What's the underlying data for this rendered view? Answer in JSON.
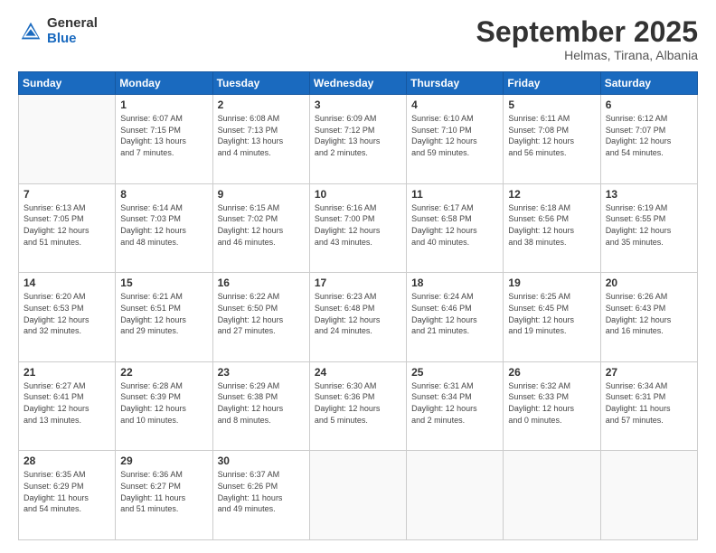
{
  "logo": {
    "general": "General",
    "blue": "Blue"
  },
  "header": {
    "month": "September 2025",
    "location": "Helmas, Tirana, Albania"
  },
  "weekdays": [
    "Sunday",
    "Monday",
    "Tuesday",
    "Wednesday",
    "Thursday",
    "Friday",
    "Saturday"
  ],
  "weeks": [
    [
      {
        "day": "",
        "info": ""
      },
      {
        "day": "1",
        "info": "Sunrise: 6:07 AM\nSunset: 7:15 PM\nDaylight: 13 hours\nand 7 minutes."
      },
      {
        "day": "2",
        "info": "Sunrise: 6:08 AM\nSunset: 7:13 PM\nDaylight: 13 hours\nand 4 minutes."
      },
      {
        "day": "3",
        "info": "Sunrise: 6:09 AM\nSunset: 7:12 PM\nDaylight: 13 hours\nand 2 minutes."
      },
      {
        "day": "4",
        "info": "Sunrise: 6:10 AM\nSunset: 7:10 PM\nDaylight: 12 hours\nand 59 minutes."
      },
      {
        "day": "5",
        "info": "Sunrise: 6:11 AM\nSunset: 7:08 PM\nDaylight: 12 hours\nand 56 minutes."
      },
      {
        "day": "6",
        "info": "Sunrise: 6:12 AM\nSunset: 7:07 PM\nDaylight: 12 hours\nand 54 minutes."
      }
    ],
    [
      {
        "day": "7",
        "info": "Sunrise: 6:13 AM\nSunset: 7:05 PM\nDaylight: 12 hours\nand 51 minutes."
      },
      {
        "day": "8",
        "info": "Sunrise: 6:14 AM\nSunset: 7:03 PM\nDaylight: 12 hours\nand 48 minutes."
      },
      {
        "day": "9",
        "info": "Sunrise: 6:15 AM\nSunset: 7:02 PM\nDaylight: 12 hours\nand 46 minutes."
      },
      {
        "day": "10",
        "info": "Sunrise: 6:16 AM\nSunset: 7:00 PM\nDaylight: 12 hours\nand 43 minutes."
      },
      {
        "day": "11",
        "info": "Sunrise: 6:17 AM\nSunset: 6:58 PM\nDaylight: 12 hours\nand 40 minutes."
      },
      {
        "day": "12",
        "info": "Sunrise: 6:18 AM\nSunset: 6:56 PM\nDaylight: 12 hours\nand 38 minutes."
      },
      {
        "day": "13",
        "info": "Sunrise: 6:19 AM\nSunset: 6:55 PM\nDaylight: 12 hours\nand 35 minutes."
      }
    ],
    [
      {
        "day": "14",
        "info": "Sunrise: 6:20 AM\nSunset: 6:53 PM\nDaylight: 12 hours\nand 32 minutes."
      },
      {
        "day": "15",
        "info": "Sunrise: 6:21 AM\nSunset: 6:51 PM\nDaylight: 12 hours\nand 29 minutes."
      },
      {
        "day": "16",
        "info": "Sunrise: 6:22 AM\nSunset: 6:50 PM\nDaylight: 12 hours\nand 27 minutes."
      },
      {
        "day": "17",
        "info": "Sunrise: 6:23 AM\nSunset: 6:48 PM\nDaylight: 12 hours\nand 24 minutes."
      },
      {
        "day": "18",
        "info": "Sunrise: 6:24 AM\nSunset: 6:46 PM\nDaylight: 12 hours\nand 21 minutes."
      },
      {
        "day": "19",
        "info": "Sunrise: 6:25 AM\nSunset: 6:45 PM\nDaylight: 12 hours\nand 19 minutes."
      },
      {
        "day": "20",
        "info": "Sunrise: 6:26 AM\nSunset: 6:43 PM\nDaylight: 12 hours\nand 16 minutes."
      }
    ],
    [
      {
        "day": "21",
        "info": "Sunrise: 6:27 AM\nSunset: 6:41 PM\nDaylight: 12 hours\nand 13 minutes."
      },
      {
        "day": "22",
        "info": "Sunrise: 6:28 AM\nSunset: 6:39 PM\nDaylight: 12 hours\nand 10 minutes."
      },
      {
        "day": "23",
        "info": "Sunrise: 6:29 AM\nSunset: 6:38 PM\nDaylight: 12 hours\nand 8 minutes."
      },
      {
        "day": "24",
        "info": "Sunrise: 6:30 AM\nSunset: 6:36 PM\nDaylight: 12 hours\nand 5 minutes."
      },
      {
        "day": "25",
        "info": "Sunrise: 6:31 AM\nSunset: 6:34 PM\nDaylight: 12 hours\nand 2 minutes."
      },
      {
        "day": "26",
        "info": "Sunrise: 6:32 AM\nSunset: 6:33 PM\nDaylight: 12 hours\nand 0 minutes."
      },
      {
        "day": "27",
        "info": "Sunrise: 6:34 AM\nSunset: 6:31 PM\nDaylight: 11 hours\nand 57 minutes."
      }
    ],
    [
      {
        "day": "28",
        "info": "Sunrise: 6:35 AM\nSunset: 6:29 PM\nDaylight: 11 hours\nand 54 minutes."
      },
      {
        "day": "29",
        "info": "Sunrise: 6:36 AM\nSunset: 6:27 PM\nDaylight: 11 hours\nand 51 minutes."
      },
      {
        "day": "30",
        "info": "Sunrise: 6:37 AM\nSunset: 6:26 PM\nDaylight: 11 hours\nand 49 minutes."
      },
      {
        "day": "",
        "info": ""
      },
      {
        "day": "",
        "info": ""
      },
      {
        "day": "",
        "info": ""
      },
      {
        "day": "",
        "info": ""
      }
    ]
  ]
}
